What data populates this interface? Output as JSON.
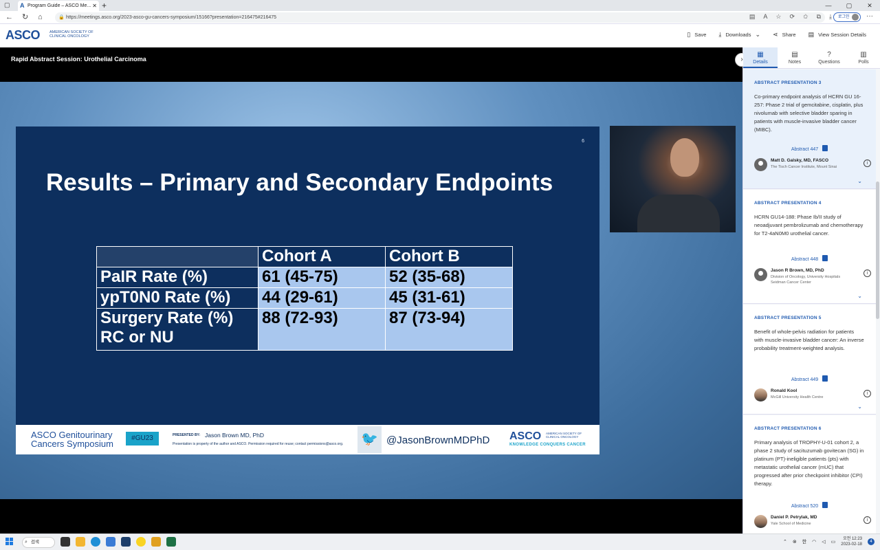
{
  "browser": {
    "tab_title": "Program Guide – ASCO Me...",
    "url": "https://meetings.asco.org/2023-asco-gu-cancers-symposium/15166?presentation=216475#216475",
    "login_label": "로그인"
  },
  "header": {
    "logo": "ASCO",
    "logo_sub": "AMERICAN SOCIETY OF CLINICAL ONCOLOGY",
    "actions": {
      "save": "Save",
      "downloads": "Downloads",
      "share": "Share",
      "view_details": "View Session Details"
    }
  },
  "video": {
    "session_title": "Rapid Abstract Session: Urothelial Carcinoma",
    "slide": {
      "number": "6",
      "title": "Results – Primary and Secondary Endpoints",
      "columns": [
        "Cohort A",
        "Cohort B"
      ],
      "rows": [
        {
          "label": "PaIR Rate (%)",
          "a": "61 (45-75)",
          "b": "52 (35-68)"
        },
        {
          "label": "ypT0N0 Rate (%)",
          "a": "44 (29-61)",
          "b": "45 (31-61)"
        },
        {
          "label": "Surgery Rate (%)",
          "label2": "RC or NU",
          "a": "88 (72-93)",
          "b": "87 (73-94)"
        }
      ],
      "footer": {
        "symposium_line1": "ASCO Genitourinary",
        "symposium_line2": "Cancers Symposium",
        "hashtag": "#GU23",
        "presented_by": "PRESENTED BY:",
        "presenter": "Jason Brown MD, PhD",
        "disclaimer": "Presentation is property of the author and ASCO. Permission required for reuse; contact permissions@asco.org.",
        "twitter_handle": "@JasonBrownMDPhD",
        "asco": "ASCO",
        "asco_sub": "AMERICAN SOCIETY OF CLINICAL ONCOLOGY",
        "tagline": "KNOWLEDGE CONQUERS CANCER"
      }
    }
  },
  "panel": {
    "tabs": [
      {
        "label": "Details",
        "icon": "book-icon"
      },
      {
        "label": "Notes",
        "icon": "note-icon"
      },
      {
        "label": "Questions",
        "icon": "question-icon"
      },
      {
        "label": "Polls",
        "icon": "chart-icon"
      }
    ],
    "cards": [
      {
        "title": "ABSTRACT PRESENTATION 3",
        "description": "Co-primary endpoint analysis of HCRN GU 16-257: Phase 2 trial of gemcitabine, cisplatin, plus nivolumab with selective bladder sparing in patients with muscle-invasive bladder cancer (MIBC).",
        "abstract": "Abstract 447",
        "author": "Matt D. Galsky, MD, FASCO",
        "affiliation": "The Tisch Cancer Institute, Mount Sinai"
      },
      {
        "title": "ABSTRACT PRESENTATION 4",
        "description": "HCRN GU14-188: Phase Ib/II study of neoadjuvant pembrolizumab and chemotherapy for T2-4aN0M0 urothelial cancer.",
        "abstract": "Abstract 448",
        "author": "Jason R Brown, MD, PhD",
        "affiliation": "Division of Oncology, University Hospitals Seidman Cancer Center"
      },
      {
        "title": "ABSTRACT PRESENTATION 5",
        "description": "Benefit of whole-pelvis radiation for patients with muscle-invasive bladder cancer: An inverse probability treatment-weighted analysis.",
        "abstract": "Abstract 449",
        "author": "Ronald Kool",
        "affiliation": "McGill University Health Centre"
      },
      {
        "title": "ABSTRACT PRESENTATION 6",
        "description": "Primary analysis of TROPHY-U-01 cohort 2, a phase 2 study of sacituzumab govitecan (SG) in platinum (PT)-ineligible patients (pts) with metastatic urothelial cancer (mUC) that progressed after prior checkpoint inhibitor (CPI) therapy.",
        "abstract": "Abstract 520",
        "author": "Daniel P. Petrylak, MD",
        "affiliation": "Yale School of Medicine"
      }
    ]
  },
  "taskbar": {
    "search": "검색",
    "lang": "한",
    "time": "오전 12:23",
    "date": "2023-02-18",
    "notifications": "4"
  }
}
